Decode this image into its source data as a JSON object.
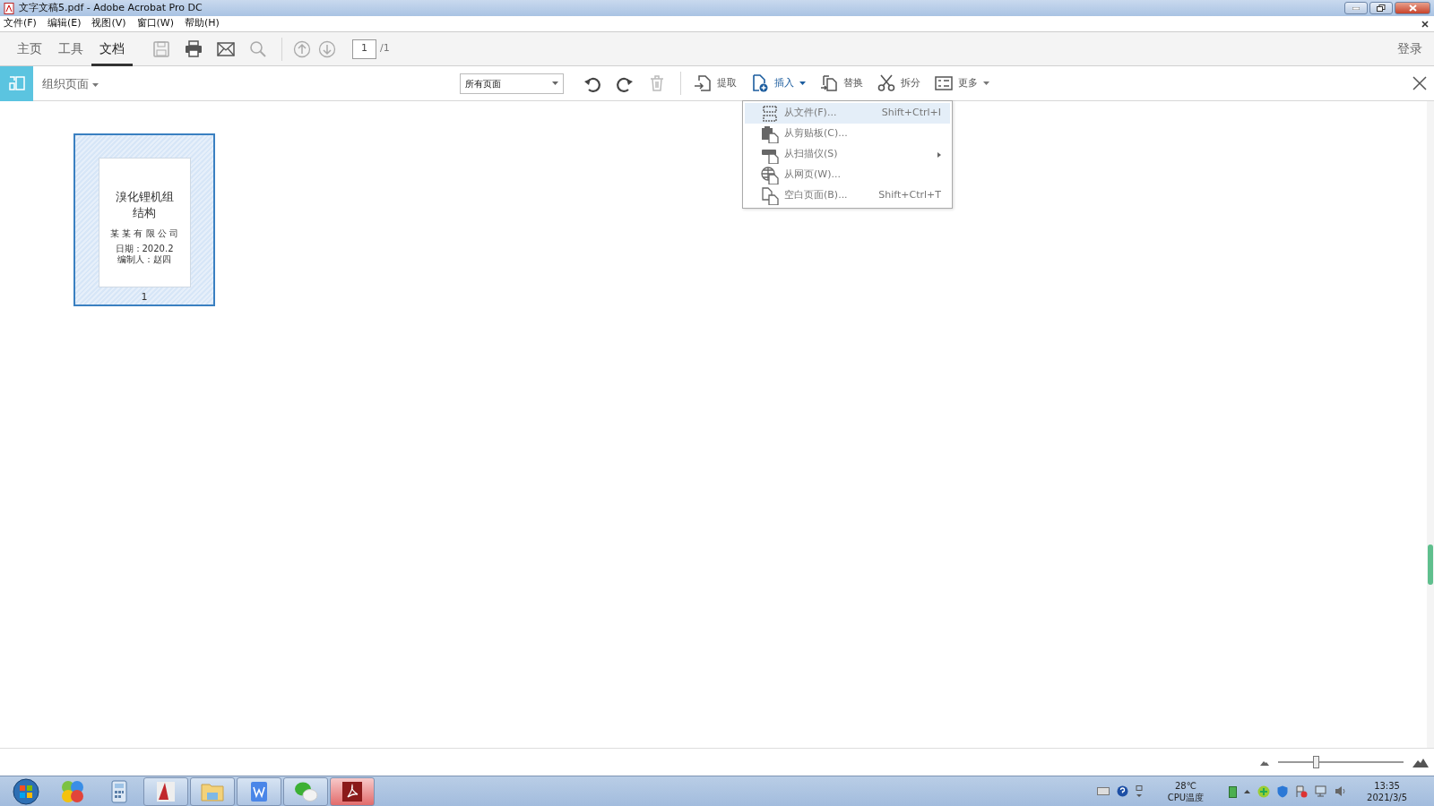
{
  "window": {
    "title": "文字文稿5.pdf - Adobe Acrobat Pro DC"
  },
  "menu_bar": [
    "文件(F)",
    "编辑(E)",
    "视图(V)",
    "窗口(W)",
    "帮助(H)"
  ],
  "nav_tabs": [
    {
      "label": "主页",
      "selected": false
    },
    {
      "label": "工具",
      "selected": false
    },
    {
      "label": "文档",
      "selected": true
    }
  ],
  "toolbar": {
    "page_number": "1",
    "page_total": "/1",
    "sign_in": "登录"
  },
  "organize_bar": {
    "title": "组织页面",
    "page_filter": "所有页面",
    "actions": [
      {
        "label": "提取",
        "kind": "button",
        "expanded": false
      },
      {
        "label": "插入",
        "kind": "dropdown",
        "expanded": true
      },
      {
        "label": "替换",
        "kind": "button",
        "expanded": false
      },
      {
        "label": "拆分",
        "kind": "button",
        "expanded": false
      },
      {
        "label": "更多",
        "kind": "dropdown",
        "expanded": false
      }
    ]
  },
  "insert_menu": [
    {
      "label": "从文件(F)...",
      "shortcut": "Shift+Ctrl+I",
      "selected": true,
      "has_submenu": false
    },
    {
      "label": "从剪贴板(C)...",
      "selected": false,
      "has_submenu": false
    },
    {
      "label": "从扫描仪(S)",
      "selected": false,
      "has_submenu": true
    },
    {
      "label": "从网页(W)...",
      "selected": false,
      "has_submenu": false
    },
    {
      "label": "空白页面(B)...",
      "shortcut": "Shift+Ctrl+T",
      "selected": false,
      "has_submenu": false
    }
  ],
  "thumbnails": [
    {
      "title_lines": [
        "溴化锂机组",
        "结构"
      ],
      "company": "某 某 有 限 公 司",
      "date": "日期：2020.2",
      "author": "编制人：赵四",
      "page_label": "1",
      "selected": true
    }
  ],
  "zoom_slider": {
    "level": 0.3
  },
  "taskbar": {
    "apps": [
      {
        "running": false,
        "selected": false
      },
      {
        "running": false,
        "selected": false
      },
      {
        "running": true,
        "selected": false
      },
      {
        "running": true,
        "selected": false
      },
      {
        "running": true,
        "selected": false
      },
      {
        "running": true,
        "selected": false
      },
      {
        "running": true,
        "selected": true
      }
    ],
    "temperature": "28℃",
    "sensor_label": "CPU温度",
    "time": "13:35",
    "date": "2021/3/5"
  }
}
